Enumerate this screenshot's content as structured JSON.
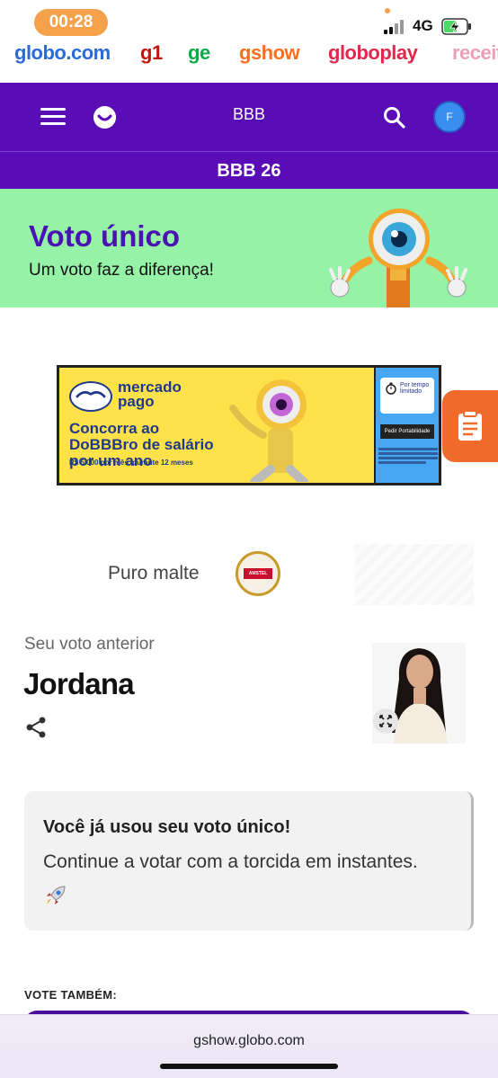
{
  "status_bar": {
    "time": "00:28",
    "network": "4G"
  },
  "portals": [
    {
      "label": "globo.com",
      "color": "#2a6bd9"
    },
    {
      "label": "g1",
      "color": "#c4170c"
    },
    {
      "label": "ge",
      "color": "#06aa48"
    },
    {
      "label": "gshow",
      "color": "#ff6e1f"
    },
    {
      "label": "globoplay",
      "color": "#e0294f"
    },
    {
      "label": "receitas",
      "color": "#e9a0ba"
    }
  ],
  "header": {
    "title": "BBB",
    "avatar_initial": "F",
    "section_title": "BBB 26",
    "bg_color": "#5a0db6"
  },
  "banner": {
    "title": "Voto único",
    "subtitle": "Um voto faz a diferença!",
    "bg_color": "#95f2a6"
  },
  "ad": {
    "brand": "mercado pago",
    "headline": "Concorra ao DoBBBro de salário por um ano",
    "fine_print": "R$ 5.000 por mês, durante 12 meses",
    "timer_label": "Por tempo limitado",
    "cta": "Pedir Portabilidade"
  },
  "sponsor": {
    "text": "Puro malte",
    "logo_text": "AMSTEL"
  },
  "previous_vote": {
    "label": "Seu voto anterior",
    "name": "Jordana"
  },
  "info": {
    "title": "Você já usou seu voto único!",
    "body": "Continue a votar com a torcida em instantes."
  },
  "vote_also": {
    "label": "VOTE TAMBÉM:"
  },
  "browser": {
    "url": "gshow.globo.com"
  }
}
